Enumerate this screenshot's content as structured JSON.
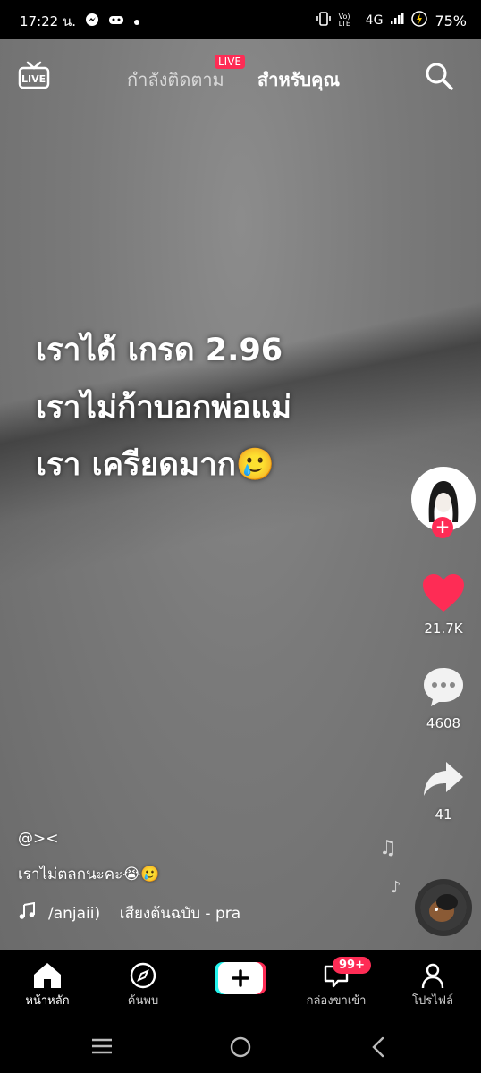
{
  "status_bar": {
    "time": "17:22 น.",
    "network": "4G",
    "volte": "Vo) LTE",
    "battery": "75%"
  },
  "top_nav": {
    "live_label": "LIVE",
    "tab_following": "กำลังติดตาม",
    "live_badge": "LIVE",
    "tab_for_you": "สำหรับคุณ"
  },
  "video": {
    "overlay_lines": [
      "เราได้ เกรด 2.96",
      "เราไม่ก้าบอกพ่อแม่",
      "เรา เครียดมาก🥲"
    ]
  },
  "actions": {
    "likes": "21.7K",
    "comments": "4608",
    "shares": "41"
  },
  "post": {
    "username": "@><",
    "caption": "เราไม่ตลกนะคะ😭🥲",
    "music": "/anjaii)    เสียงต้นฉบับ - pra"
  },
  "bottom_nav": {
    "home": "หน้าหลัก",
    "discover": "ค้นพบ",
    "inbox": "กล่องขาเข้า",
    "inbox_badge": "99+",
    "profile": "โปรไฟล์"
  },
  "colors": {
    "accent": "#fe2c55",
    "bg": "#000000"
  }
}
